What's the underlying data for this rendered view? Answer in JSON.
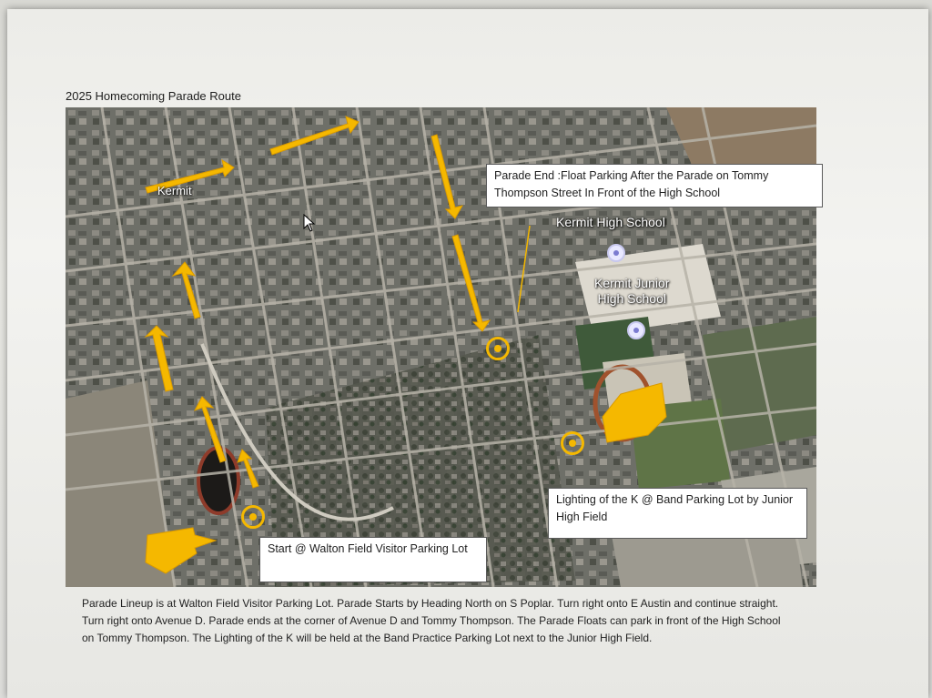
{
  "document": {
    "title": "2025 Homecoming Parade Route"
  },
  "map": {
    "labels": {
      "town": "Kermit",
      "high_school": "Kermit High School",
      "junior_high_line1": "Kermit Junior",
      "junior_high_line2": "High School"
    },
    "route_color": "#f5b800",
    "callouts": {
      "end": "Parade End :Float Parking After the Parade on Tommy Thompson Street In Front of the High School",
      "lighting": "Lighting of the K @ Band Parking Lot by Junior High Field",
      "start": "Start @ Walton Field Visitor Parking Lot"
    }
  },
  "caption": {
    "line1": "Parade Lineup is at Walton Field Visitor Parking Lot. Parade Starts by Heading North on S Poplar. Turn right onto E Austin and continue straight.",
    "line2": "Turn right onto Avenue D. Parade ends at the corner of Avenue D and Tommy Thompson. The Parade Floats can park in front of the High School",
    "line3": "on Tommy Thompson. The Lighting of the K will be held at the Band Practice Parking Lot next to the Junior High Field."
  }
}
